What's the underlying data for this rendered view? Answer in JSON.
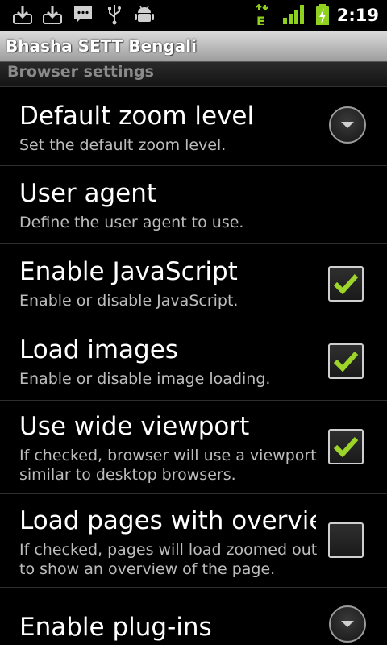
{
  "status_bar": {
    "time": "2:19",
    "icons": [
      "download-icon",
      "download-market-icon",
      "sms-icon",
      "usb-icon",
      "android-debug-icon",
      "edge-data-icon",
      "signal-icon",
      "battery-charging-icon"
    ],
    "network_type": "E"
  },
  "title_bar": {
    "title": "Bhasha SETT Bengali"
  },
  "category": {
    "label": "Browser settings"
  },
  "preferences": [
    {
      "title": "Default zoom level",
      "summary": "Set the default zoom level.",
      "widget": "dropdown"
    },
    {
      "title": "User agent",
      "summary": "Define the user agent to use.",
      "widget": "none"
    },
    {
      "title": "Enable JavaScript",
      "summary": "Enable or disable JavaScript.",
      "widget": "checkbox",
      "checked": true
    },
    {
      "title": "Load images",
      "summary": "Enable or disable image loading.",
      "widget": "checkbox",
      "checked": true
    },
    {
      "title": "Use wide viewport",
      "summary": "If checked, browser will use a viewport similar to desktop browsers.",
      "widget": "checkbox",
      "checked": true
    },
    {
      "title": "Load pages with overview",
      "summary": "If checked, pages will load zoomed out to show an overview of the page.",
      "widget": "checkbox",
      "checked": false
    },
    {
      "title": "Enable plug-ins",
      "summary": "",
      "widget": "dropdown"
    }
  ],
  "colors": {
    "check": "#9dd42a",
    "signal": "#8fd11f",
    "battery": "#8fd11f"
  }
}
